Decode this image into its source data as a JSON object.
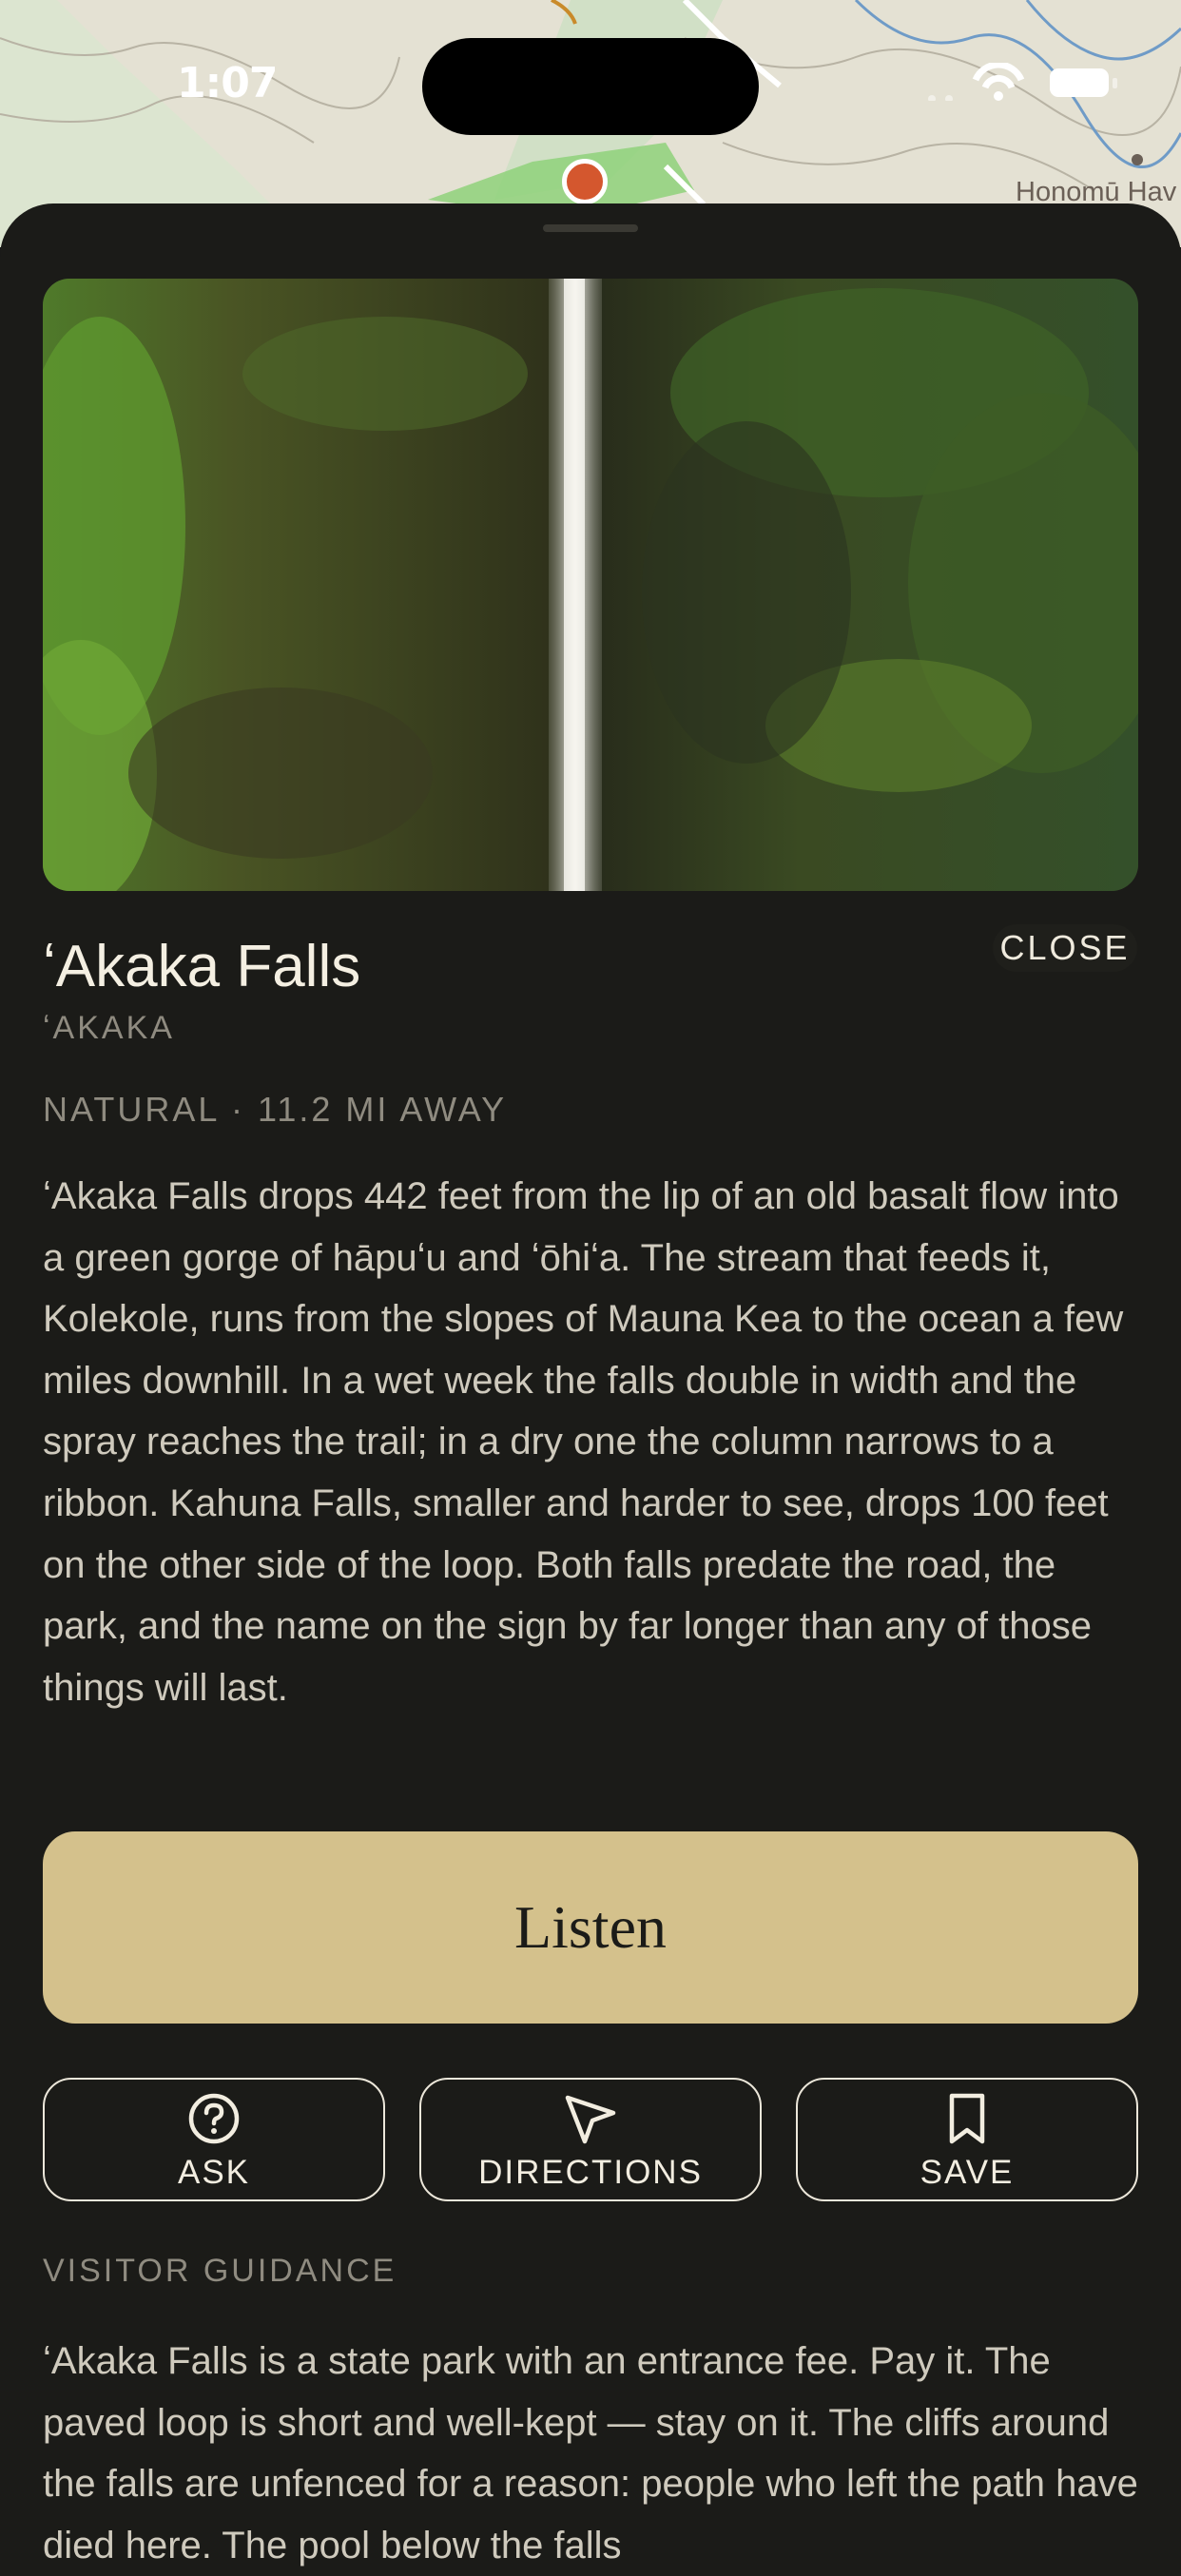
{
  "status_bar": {
    "time": "1:07"
  },
  "map": {
    "place_label": "Honomū Hav"
  },
  "place": {
    "title": "ʻAkaka Falls",
    "native_name": "ʻAKAKA",
    "meta": "NATURAL · 11.2 MI AWAY",
    "close_label": "CLOSE",
    "description": "ʻAkaka Falls drops 442 feet from the lip of an old basalt flow into a green gorge of hāpuʻu and ʻōhiʻa. The stream that feeds it, Kolekole, runs from the slopes of Mauna Kea to the ocean a few miles downhill. In a wet week the falls double in width and the spray reaches the trail; in a dry one the column narrows to a ribbon. Kahuna Falls, smaller and harder to see, drops 100 feet on the other side of the loop. Both falls predate the road, the park, and the name on the sign by far longer than any of those things will last."
  },
  "actions": {
    "listen_label": "Listen",
    "ask_label": "ASK",
    "directions_label": "DIRECTIONS",
    "save_label": "SAVE"
  },
  "guidance": {
    "heading": "VISITOR GUIDANCE",
    "text": "ʻAkaka Falls is a state park with an entrance fee. Pay it. The paved loop is short and well-kept — stay on it. The cliffs around the falls are unfenced for a reason: people who left the path have died here. The pool below the falls"
  },
  "colors": {
    "sheet_background": "#1b1b18",
    "listen_button": "#d4c18c",
    "map_pin": "#d4572e"
  },
  "icons": [
    "question-circle-icon",
    "navigation-arrow-icon",
    "bookmark-icon",
    "wifi-icon",
    "battery-icon",
    "waterfall-photo"
  ]
}
